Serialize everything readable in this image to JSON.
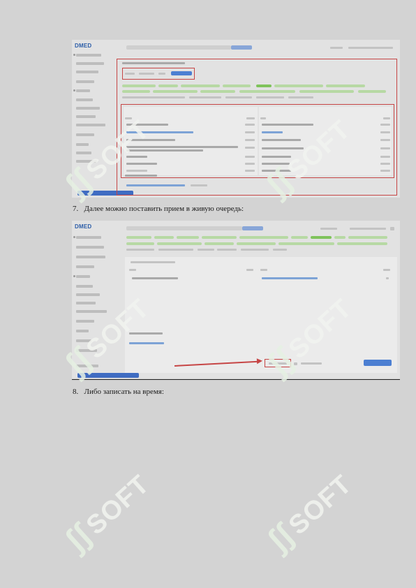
{
  "shot1": {
    "logo": "DMED",
    "tab_active_label": "",
    "status_label": ""
  },
  "shot2": {
    "logo": "DMED"
  },
  "step7": {
    "number": "7.",
    "text": "Далее можно поставить прием в живую очередь:"
  },
  "step8": {
    "number": "8.",
    "text": "Либо записать на время:"
  },
  "watermark": {
    "word": "SOFT",
    "glyph": "ʃʃ"
  },
  "colors": {
    "highlight_red": "#c64545",
    "accent_blue": "#4c7fd2",
    "chip_green": "#b7d9a4",
    "watermark": "#f2f4f0"
  }
}
